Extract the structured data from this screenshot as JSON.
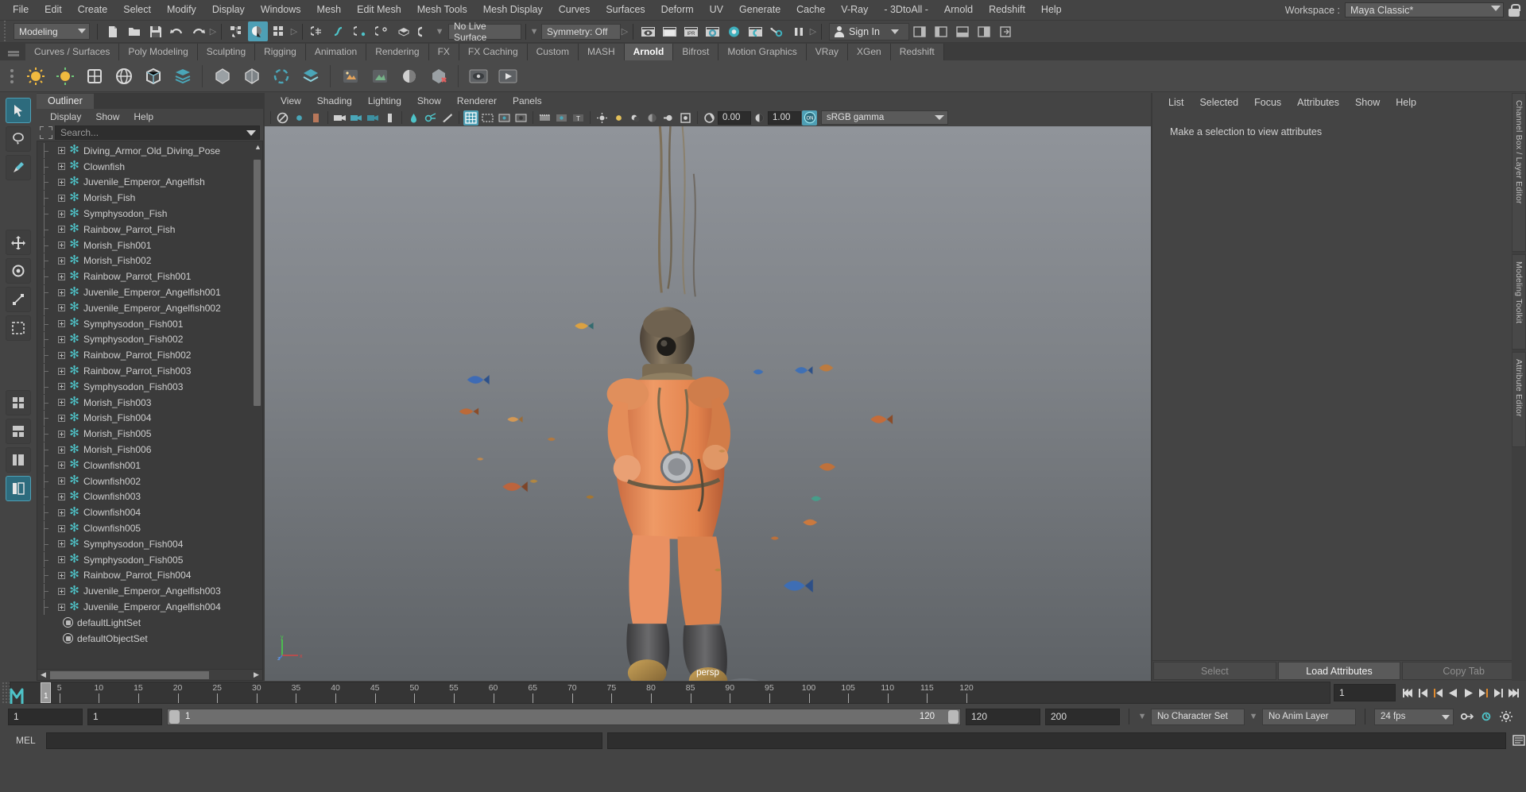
{
  "app": {
    "title": "Autodesk Maya",
    "accent": "#4e9fb5",
    "bg": "#444444"
  },
  "menubar": {
    "items": [
      "File",
      "Edit",
      "Create",
      "Select",
      "Modify",
      "Display",
      "Windows",
      "Mesh",
      "Edit Mesh",
      "Mesh Tools",
      "Mesh Display",
      "Curves",
      "Surfaces",
      "Deform",
      "UV",
      "Generate",
      "Cache",
      "V-Ray",
      "- 3DtoAll -",
      "Arnold",
      "Redshift",
      "Help"
    ],
    "workspace_label": "Workspace :",
    "workspace_value": "Maya Classic*"
  },
  "statusbar": {
    "mode": "Modeling",
    "live_surface": "No Live Surface",
    "symmetry": "Symmetry: Off",
    "sign_in": "Sign In",
    "ipr_label": "IPR"
  },
  "shelf": {
    "tabs": [
      "Curves / Surfaces",
      "Poly Modeling",
      "Sculpting",
      "Rigging",
      "Animation",
      "Rendering",
      "FX",
      "FX Caching",
      "Custom",
      "MASH",
      "Arnold",
      "Bifrost",
      "Motion Graphics",
      "VRay",
      "XGen",
      "Redshift"
    ],
    "active_tab": "Arnold"
  },
  "outliner": {
    "tab": "Outliner",
    "menu": [
      "Display",
      "Show",
      "Help"
    ],
    "search_placeholder": "Search...",
    "items": [
      {
        "label": "Diving_Armor_Old_Diving_Pose",
        "icon": "transform-star-icon"
      },
      {
        "label": "Clownfish",
        "icon": "transform-star-icon"
      },
      {
        "label": "Juvenile_Emperor_Angelfish",
        "icon": "transform-star-icon"
      },
      {
        "label": "Morish_Fish",
        "icon": "transform-star-icon"
      },
      {
        "label": "Symphysodon_Fish",
        "icon": "transform-star-icon"
      },
      {
        "label": "Rainbow_Parrot_Fish",
        "icon": "transform-star-icon"
      },
      {
        "label": "Morish_Fish001",
        "icon": "transform-star-icon"
      },
      {
        "label": "Morish_Fish002",
        "icon": "transform-star-icon"
      },
      {
        "label": "Rainbow_Parrot_Fish001",
        "icon": "transform-star-icon"
      },
      {
        "label": "Juvenile_Emperor_Angelfish001",
        "icon": "transform-star-icon"
      },
      {
        "label": "Juvenile_Emperor_Angelfish002",
        "icon": "transform-star-icon"
      },
      {
        "label": "Symphysodon_Fish001",
        "icon": "transform-star-icon"
      },
      {
        "label": "Symphysodon_Fish002",
        "icon": "transform-star-icon"
      },
      {
        "label": "Rainbow_Parrot_Fish002",
        "icon": "transform-star-icon"
      },
      {
        "label": "Rainbow_Parrot_Fish003",
        "icon": "transform-star-icon"
      },
      {
        "label": "Symphysodon_Fish003",
        "icon": "transform-star-icon"
      },
      {
        "label": "Morish_Fish003",
        "icon": "transform-star-icon"
      },
      {
        "label": "Morish_Fish004",
        "icon": "transform-star-icon"
      },
      {
        "label": "Morish_Fish005",
        "icon": "transform-star-icon"
      },
      {
        "label": "Morish_Fish006",
        "icon": "transform-star-icon"
      },
      {
        "label": "Clownfish001",
        "icon": "transform-star-icon"
      },
      {
        "label": "Clownfish002",
        "icon": "transform-star-icon"
      },
      {
        "label": "Clownfish003",
        "icon": "transform-star-icon"
      },
      {
        "label": "Clownfish004",
        "icon": "transform-star-icon"
      },
      {
        "label": "Clownfish005",
        "icon": "transform-star-icon"
      },
      {
        "label": "Symphysodon_Fish004",
        "icon": "transform-star-icon"
      },
      {
        "label": "Symphysodon_Fish005",
        "icon": "transform-star-icon"
      },
      {
        "label": "Rainbow_Parrot_Fish004",
        "icon": "transform-star-icon"
      },
      {
        "label": "Juvenile_Emperor_Angelfish003",
        "icon": "transform-star-icon"
      },
      {
        "label": "Juvenile_Emperor_Angelfish004",
        "icon": "transform-star-icon"
      },
      {
        "label": "defaultLightSet",
        "icon": "set-icon"
      },
      {
        "label": "defaultObjectSet",
        "icon": "set-icon"
      }
    ]
  },
  "viewport": {
    "menu": [
      "View",
      "Shading",
      "Lighting",
      "Show",
      "Renderer",
      "Panels"
    ],
    "exposure": "0.00",
    "gamma_value": "1.00",
    "color_mgmt": "sRGB gamma",
    "camera_label": "persp",
    "axis_x": "x",
    "axis_y": "y",
    "axis_z": "z"
  },
  "attribute_editor": {
    "menu": [
      "List",
      "Selected",
      "Focus",
      "Attributes",
      "Show",
      "Help"
    ],
    "empty_message": "Make a selection to view attributes",
    "buttons": [
      {
        "label": "Select",
        "enabled": false
      },
      {
        "label": "Load Attributes",
        "enabled": true
      },
      {
        "label": "Copy Tab",
        "enabled": false
      }
    ]
  },
  "right_tabs": [
    "Channel Box / Layer Editor",
    "Modeling Toolkit",
    "Attribute Editor"
  ],
  "timeline": {
    "ticks": [
      5,
      10,
      15,
      20,
      25,
      30,
      35,
      40,
      45,
      50,
      55,
      60,
      65,
      70,
      75,
      80,
      85,
      90,
      95,
      100,
      105,
      110,
      115,
      120
    ],
    "start": 1,
    "end": 120,
    "current_frame": "1",
    "playhead_label": "1",
    "range_start": "1",
    "range_end": "1",
    "range_bar_start": "1",
    "range_bar_end": "120",
    "anim_end": "120",
    "playback_end": "200",
    "character_set": "No Character Set",
    "anim_layer": "No Anim Layer",
    "fps": "24 fps"
  },
  "command_line": {
    "label": "MEL",
    "value": ""
  }
}
